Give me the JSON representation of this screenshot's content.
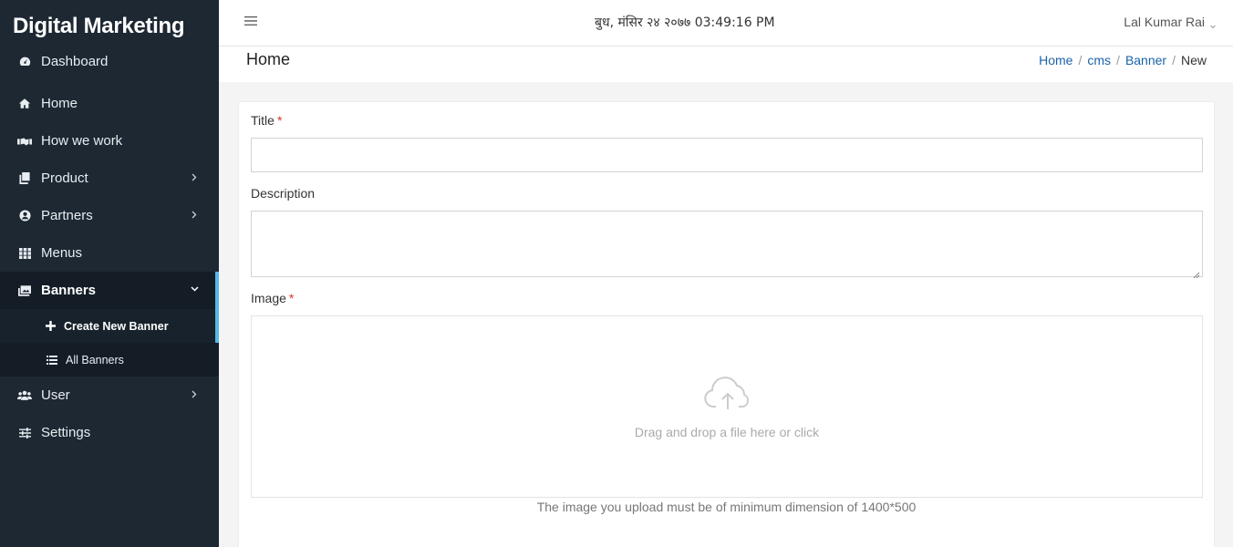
{
  "sidebar": {
    "brand": "Digital Marketing",
    "items": [
      {
        "label": "Dashboard",
        "icon": "dashboard-icon"
      },
      {
        "label": "Home",
        "icon": "home-icon"
      },
      {
        "label": "How we work",
        "icon": "handshake-icon"
      },
      {
        "label": "Product",
        "icon": "copy-icon"
      },
      {
        "label": "Partners",
        "icon": "user-circle-icon"
      },
      {
        "label": "Menus",
        "icon": "grid-icon"
      },
      {
        "label": "Banners",
        "icon": "images-icon"
      },
      {
        "label": "User",
        "icon": "users-icon"
      },
      {
        "label": "Settings",
        "icon": "sliders-icon"
      }
    ],
    "banners_sub": [
      {
        "label": "Create New Banner",
        "icon": "plus-icon"
      },
      {
        "label": "All Banners",
        "icon": "list-icon"
      }
    ],
    "accent_color": "#56b8e6",
    "background_color": "#1d2833"
  },
  "topbar": {
    "datetime": "बुध, मंसिर २४ २०७७ 03:49:16 PM",
    "user_name": "Lal Kumar Rai"
  },
  "page": {
    "title": "Home",
    "breadcrumb": [
      "Home",
      "cms",
      "Banner",
      "New"
    ]
  },
  "form": {
    "title_label": "Title",
    "title_value": "",
    "description_label": "Description",
    "description_value": "",
    "image_label": "Image",
    "required_mark": "*",
    "dropzone_text": "Drag and drop a file here or click",
    "image_help": "The image you upload must be of minimum dimension of 1400*500"
  }
}
